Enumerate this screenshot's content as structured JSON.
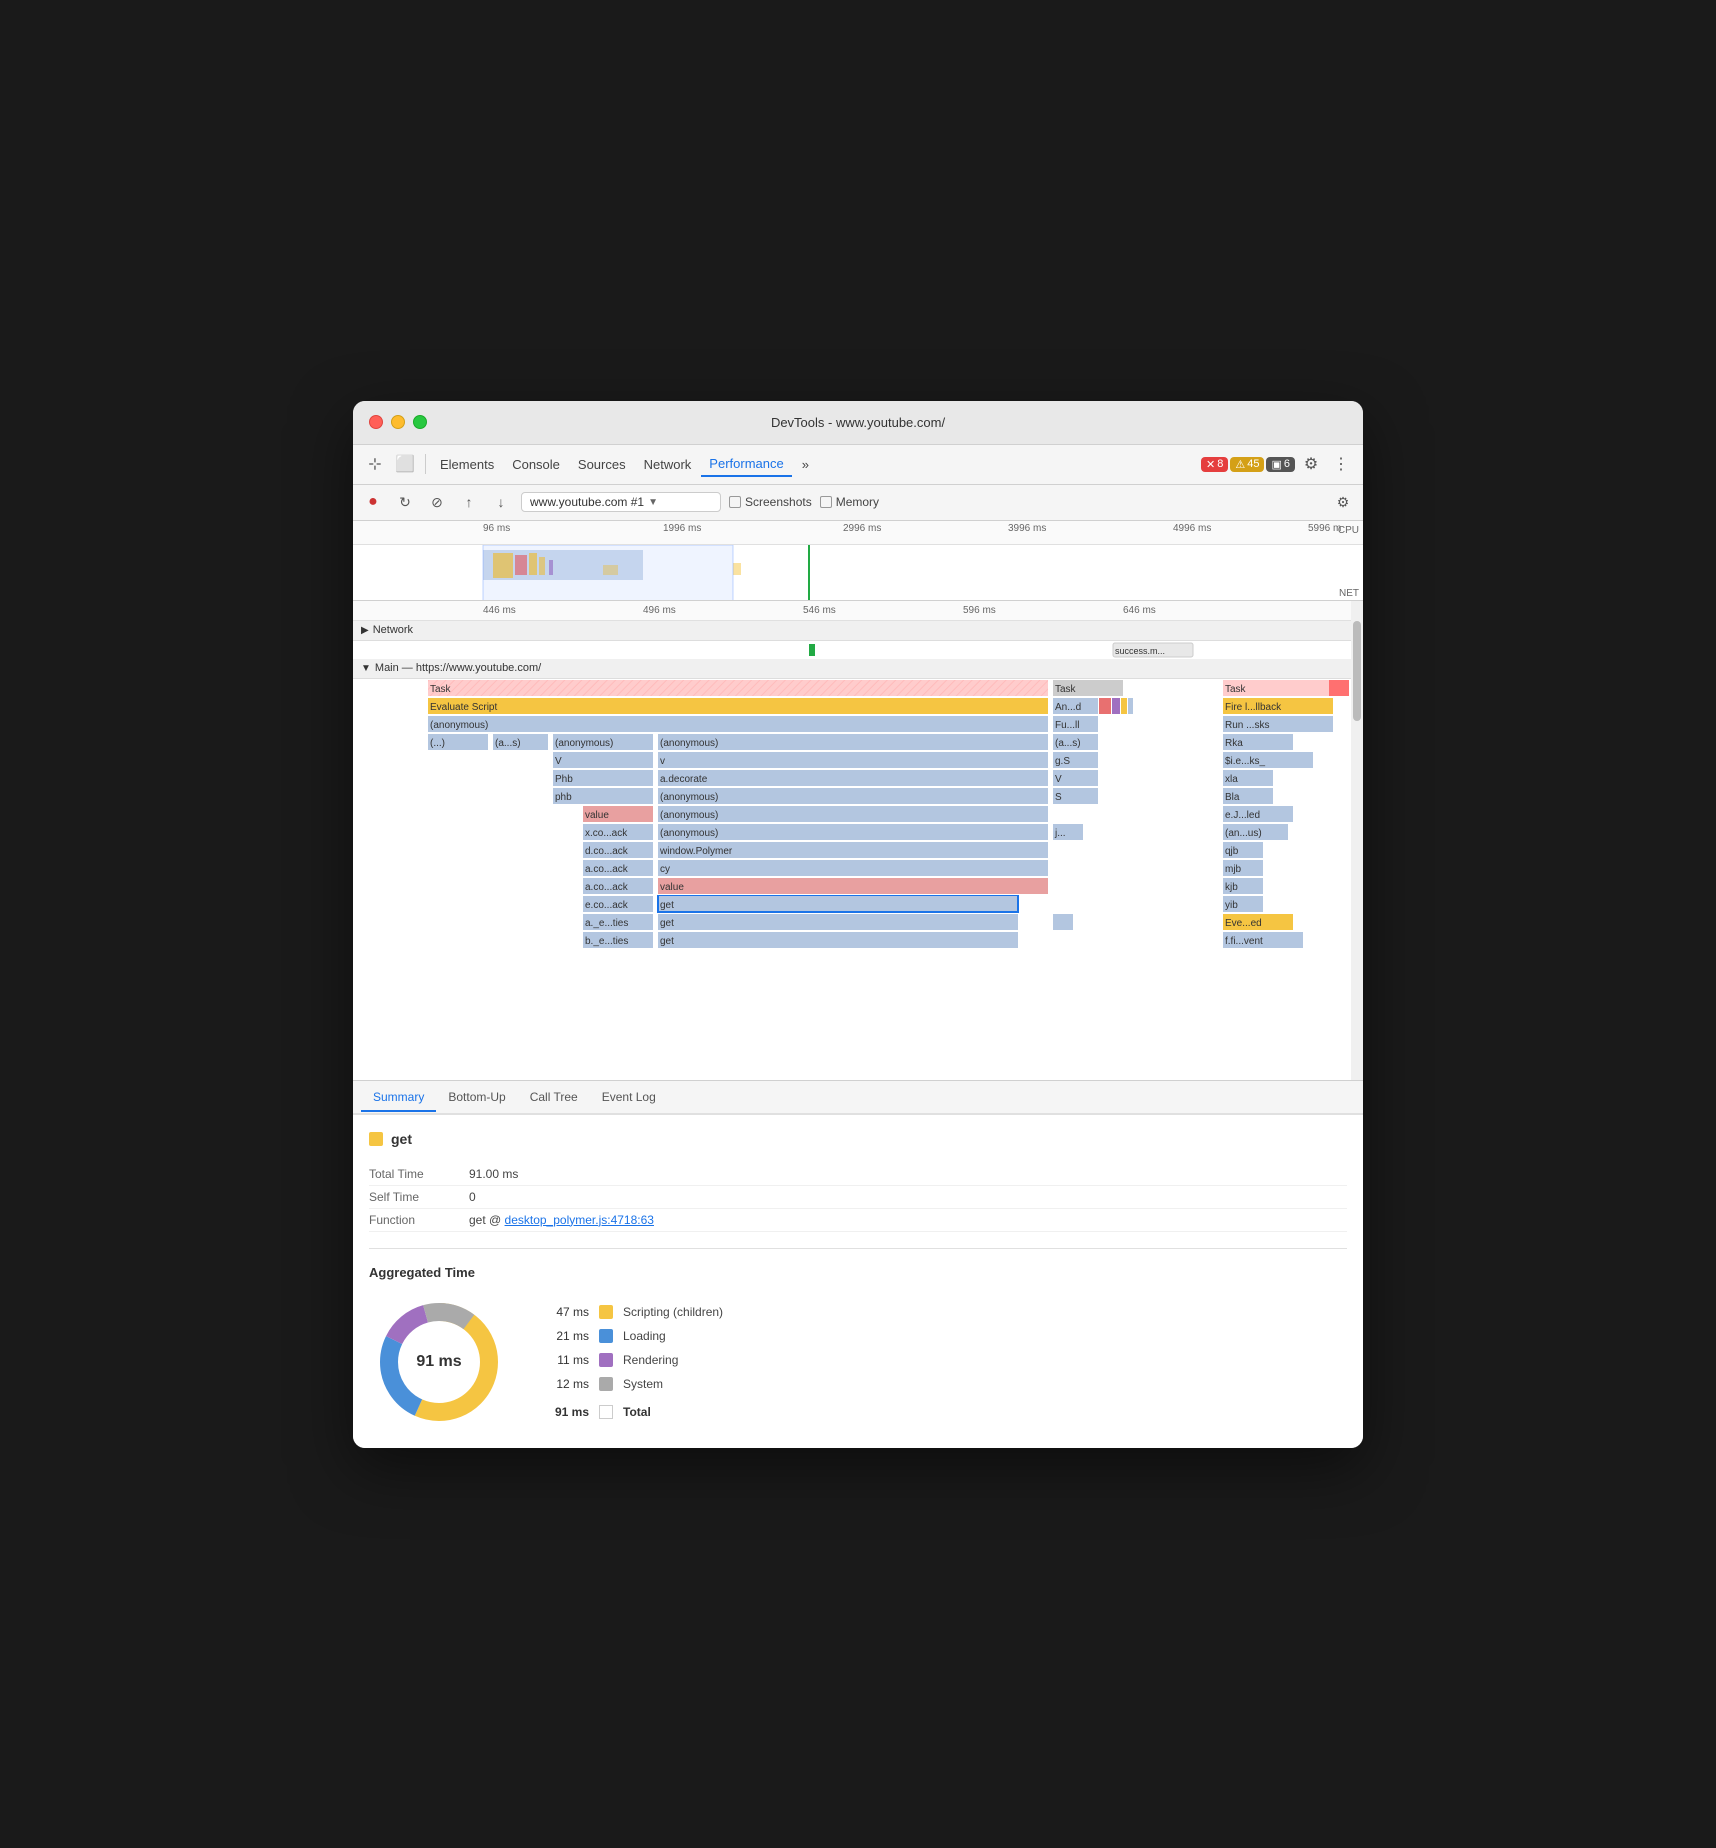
{
  "window": {
    "title": "DevTools - www.youtube.com/"
  },
  "toolbar": {
    "tabs": [
      "Elements",
      "Console",
      "Sources",
      "Network",
      "Performance",
      "»"
    ],
    "active_tab": "Performance",
    "badges": {
      "error": {
        "icon": "✕",
        "count": "8"
      },
      "warning": {
        "icon": "⚠",
        "count": "45"
      },
      "info": {
        "icon": "▣",
        "count": "6"
      }
    },
    "settings_icon": "⚙",
    "more_icon": "⋮"
  },
  "recording_bar": {
    "record_icon": "●",
    "refresh_icon": "↻",
    "clear_icon": "⊘",
    "export_icon": "↑",
    "import_icon": "↓",
    "url": "www.youtube.com #1",
    "screenshots_label": "Screenshots",
    "memory_label": "Memory",
    "settings_icon": "⚙"
  },
  "timeline": {
    "ruler_marks": [
      "96 ms",
      "1996 ms",
      "2996 ms",
      "3996 ms",
      "4996 ms",
      "5996 m"
    ],
    "ruler_mark_positions": [
      130,
      320,
      490,
      655,
      820,
      955
    ],
    "cpu_label": "CPU",
    "net_label": "NET"
  },
  "flamegraph": {
    "ruler_marks": [
      "446 ms",
      "496 ms",
      "546 ms",
      "596 ms",
      "646 ms"
    ],
    "ruler_positions": [
      130,
      290,
      450,
      610,
      770
    ],
    "network_label": "Network",
    "main_label": "Main — https://www.youtube.com/",
    "success_label": "success.m...",
    "rows": [
      {
        "label": "Task",
        "color": "#e8c0c0",
        "stripe": true,
        "right_labels": [
          "Task",
          "Task"
        ]
      },
      {
        "label": "Evaluate Script",
        "color": "#f5c542",
        "right_labels": [
          "An...d",
          "Fire l...llback"
        ]
      },
      {
        "label": "(anonymous)",
        "color": "#b3c6e0",
        "right_labels": [
          "Fu...ll",
          "Run ...sks"
        ]
      },
      {
        "label": "(...)",
        "color": "#b3c6e0",
        "label2": "(a...s)",
        "label3": "(anonymous)",
        "label4": "(anonymous)",
        "right_labels": [
          "(a...s)",
          "Rka"
        ]
      },
      {
        "label": "",
        "label3": "V",
        "label4": "v",
        "right_labels": [
          "g.S",
          "$i.e...ks_"
        ]
      },
      {
        "label": "",
        "label3": "Phb",
        "label4": "a.decorate",
        "right_labels": [
          "V",
          "xla"
        ]
      },
      {
        "label": "",
        "label3": "phb",
        "label4": "(anonymous)",
        "right_labels": [
          "S",
          "Bla"
        ]
      },
      {
        "label": "",
        "label3": "value",
        "color3": "#e8a0a0",
        "label4": "(anonymous)",
        "right_labels": [
          "",
          "e.J...led"
        ]
      },
      {
        "label": "",
        "label3": "x.co...ack",
        "label4": "(anonymous)",
        "right_labels": [
          "j...",
          "(an...us)"
        ]
      },
      {
        "label": "",
        "label3": "d.co...ack",
        "label4": "window.Polymer",
        "right_labels": [
          "",
          "qjb"
        ]
      },
      {
        "label": "",
        "label3": "a.co...ack",
        "label4": "cy",
        "right_labels": [
          "",
          "mjb"
        ]
      },
      {
        "label": "",
        "label3": "a.co...ack",
        "label4": "value",
        "color4": "#e8a0a0",
        "right_labels": [
          "",
          "kjb"
        ]
      },
      {
        "label": "",
        "label3": "e.co...ack",
        "label4": "get",
        "selected": true,
        "right_labels": [
          "",
          "yib"
        ]
      },
      {
        "label": "",
        "label3": "a._e...ties",
        "label4": "get",
        "right_labels": [
          "",
          "Eve...ed"
        ]
      },
      {
        "label": "",
        "label3": "b._e...ties",
        "label4": "get",
        "right_labels": [
          "",
          "f.fi...vent"
        ]
      }
    ]
  },
  "tabs": {
    "items": [
      "Summary",
      "Bottom-Up",
      "Call Tree",
      "Event Log"
    ],
    "active": "Summary"
  },
  "summary": {
    "title": "get",
    "title_color": "#f5c542",
    "total_time_label": "Total Time",
    "total_time_value": "91.00 ms",
    "self_time_label": "Self Time",
    "self_time_value": "0",
    "function_label": "Function",
    "function_text": "get @ ",
    "function_link": "desktop_polymer.js:4718:63",
    "agg_title": "Aggregated Time",
    "donut_label": "91 ms",
    "legend": [
      {
        "ms": "47 ms",
        "label": "Scripting (children)",
        "color": "#f5c542"
      },
      {
        "ms": "21 ms",
        "label": "Loading",
        "color": "#4a90d9"
      },
      {
        "ms": "11 ms",
        "label": "Rendering",
        "color": "#a070c0"
      },
      {
        "ms": "12 ms",
        "label": "System",
        "color": "#aaaaaa"
      }
    ],
    "total_row": {
      "ms": "91 ms",
      "label": "Total"
    }
  }
}
